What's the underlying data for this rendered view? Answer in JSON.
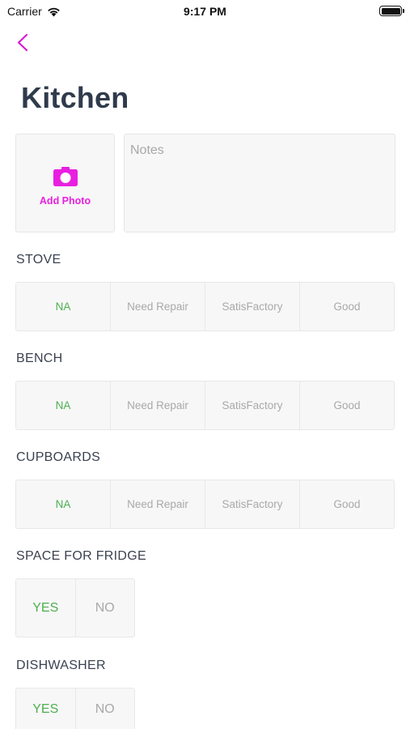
{
  "status_bar": {
    "carrier": "Carrier",
    "time": "9:17 PM"
  },
  "page": {
    "title": "Kitchen"
  },
  "photo": {
    "add_label": "Add Photo"
  },
  "notes": {
    "placeholder": "Notes"
  },
  "colors": {
    "accent": "#e81fe0",
    "selected": "#4caf50",
    "unselected": "#a9a9a9"
  },
  "sections": {
    "stove": {
      "label": "STOVE",
      "options": [
        "NA",
        "Need Repair",
        "SatisFactory",
        "Good"
      ],
      "selected": "NA"
    },
    "bench": {
      "label": "BENCH",
      "options": [
        "NA",
        "Need Repair",
        "SatisFactory",
        "Good"
      ],
      "selected": "NA"
    },
    "cupboards": {
      "label": "CUPBOARDS",
      "options": [
        "NA",
        "Need Repair",
        "SatisFactory",
        "Good"
      ],
      "selected": "NA"
    },
    "fridge": {
      "label": "SPACE FOR FRIDGE",
      "options": [
        "YES",
        "NO"
      ],
      "selected": "YES"
    },
    "dishwasher": {
      "label": "DISHWASHER",
      "options": [
        "YES",
        "NO"
      ],
      "selected": "YES"
    }
  }
}
